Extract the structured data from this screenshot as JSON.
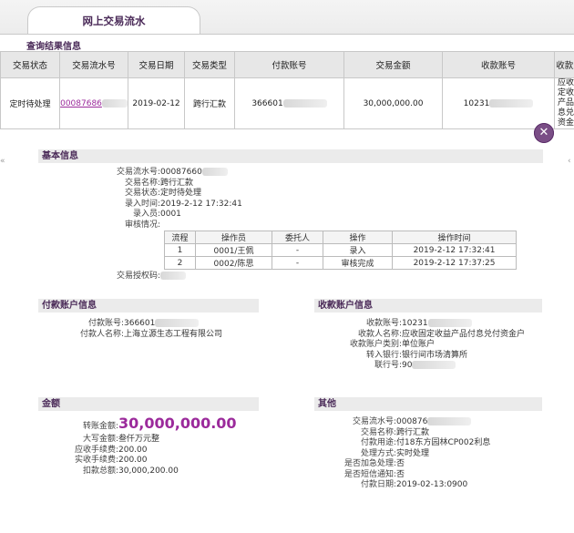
{
  "tab": {
    "title": "网上交易流水"
  },
  "query": {
    "section_title": "查询结果信息",
    "columns": [
      "交易状态",
      "交易流水号",
      "交易日期",
      "交易类型",
      "付款账号",
      "交易金额",
      "收款账号",
      "收款人"
    ],
    "row": {
      "status": "定时待处理",
      "serial": "00087686",
      "date": "2019-02-12",
      "type": "跨行汇款",
      "payer_account": "366601",
      "amount": "30,000,000.00",
      "payee_account": "10231",
      "payee_name": "应收固定收益产品付息兑付资金户"
    }
  },
  "close_icon": "close-icon",
  "arrows": {
    "left": "«",
    "right": "‹"
  },
  "basic": {
    "title": "基本信息",
    "serial_label": "交易流水号:",
    "serial_value": "00087660",
    "name_label": "交易名称:",
    "name_value": "跨行汇款",
    "status_label": "交易状态:",
    "status_value": "定时待处理",
    "input_time_label": "录入时间:",
    "input_time_value": "2019-2-12 17:32:41",
    "inputter_label": "录入员:",
    "inputter_value": "0001",
    "audit_label": "审核情况:",
    "audit_columns": [
      "流程",
      "操作员",
      "委托人",
      "操作",
      "操作时间"
    ],
    "audit_rows": [
      [
        "1",
        "0001/王佩",
        "-",
        "录入",
        "2019-2-12 17:32:41"
      ],
      [
        "2",
        "0002/陈思",
        "-",
        "审核完成",
        "2019-2-12 17:37:25"
      ]
    ],
    "auth_code_label": "交易授权码:"
  },
  "payer": {
    "title": "付款账户信息",
    "account_label": "付款账号:",
    "account_value": "366601",
    "name_label": "付款人名称:",
    "name_value": "上海立源生态工程有限公司"
  },
  "payee": {
    "title": "收款账户信息",
    "account_label": "收款账号:",
    "account_value": "10231",
    "name_label": "收款人名称:",
    "name_value": "应收固定收益产品付息兑付资金户",
    "category_label": "收款账户类别:",
    "category_value": "单位账户",
    "bank_label": "转入银行:",
    "bank_value": "银行间市场清算所",
    "bank_no_label": "联行号:",
    "bank_no_value": "90"
  },
  "amount": {
    "title": "金额",
    "transfer_label": "转账金额:",
    "transfer_value": "30,000,000.00",
    "caps_label": "大写金额:",
    "caps_value": "叁仟万元整",
    "fee_due_label": "应收手续费:",
    "fee_due_value": "200.00",
    "fee_paid_label": "实收手续费:",
    "fee_paid_value": "200.00",
    "total_label": "扣款总额:",
    "total_value": "30,000,200.00"
  },
  "other": {
    "title": "其他",
    "serial_label": "交易流水号:",
    "serial_value": "000876",
    "name_label": "交易名称:",
    "name_value": "跨行汇款",
    "purpose_label": "付款用途:",
    "purpose_value": "付18东方园林CP002利息",
    "method_label": "处理方式:",
    "method_value": "实时处理",
    "urgent_label": "是否加急处理:",
    "urgent_value": "否",
    "sms_label": "是否短信通知:",
    "sms_value": "否",
    "pay_date_label": "付款日期:",
    "pay_date_value": "2019-02-13:0900"
  }
}
